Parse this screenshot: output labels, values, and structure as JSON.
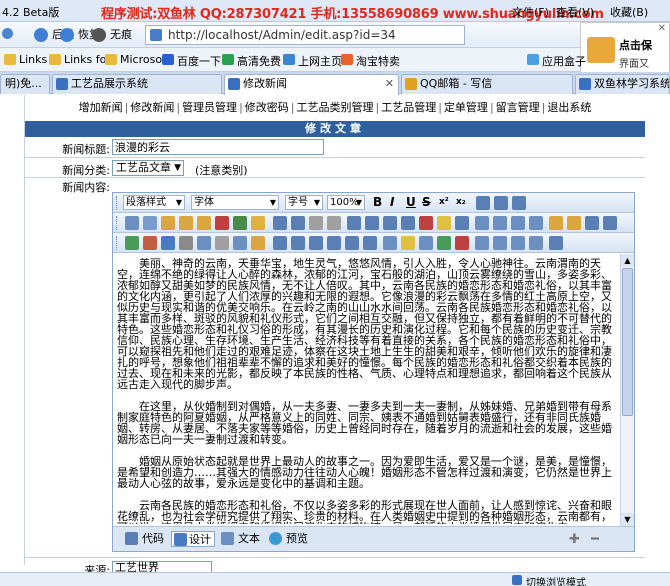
{
  "browser": {
    "app_title": "4.2 Beta版",
    "promo_text": "程序测试:双鱼林 QQ:287307421 手机:13558690869 www.shuangyulin.com",
    "menu": [
      "文件(F)",
      "查看(V)",
      "收藏(B)"
    ],
    "nav": {
      "back": "后退",
      "forward": "恢复",
      "no_record": "无痕"
    },
    "url": "http://localhost/Admin/edit.asp?id=34",
    "bookmarks": [
      "Links",
      "Links fo",
      "Microso",
      "百度一下",
      "高清免费",
      "上网主页",
      "淘宝特卖",
      "应用盒子"
    ],
    "tabs": [
      {
        "label": "明)免...",
        "active": false
      },
      {
        "label": "工艺品展示系统",
        "active": false
      },
      {
        "label": "修改新闻",
        "active": true
      },
      {
        "label": "QQ邮箱 - 写信",
        "active": false
      },
      {
        "label": "双鱼林学习系统",
        "active": false
      }
    ],
    "popup": {
      "line1": "点击保",
      "line2": "界面又"
    },
    "status_mode": "切换浏览模式"
  },
  "admin_nav": [
    "增加新闻",
    "修改新闻",
    "管理员管理",
    "修改密码",
    "工艺品类别管理",
    "工艺品管理",
    "定单管理",
    "留言管理",
    "退出系统"
  ],
  "form": {
    "header": "修改文章",
    "title_label": "新闻标题:",
    "title_value": "浪漫的彩云",
    "category_label": "新闻分类:",
    "category_value": "工艺品文章",
    "category_hint": "(注意类别)",
    "content_label": "新闻内容:",
    "source_label": "来源:",
    "source_value": "工艺世界"
  },
  "editor": {
    "paragraph_style": "段落样式",
    "font": "字体",
    "font_size": "字号",
    "zoom": "100%",
    "modes": [
      "代码",
      "设计",
      "文本",
      "预览"
    ],
    "active_mode": "设计",
    "paragraphs": [
      "美丽、神奇的云南，天垂华宝，地生灵气，悠悠风情，引人入胜，令人心驰神往。云南渭南的天空，连绵不绝的绿得让人心醉的森林，浓郁的江河，宝石般的湖泊，山顶云雾缭绕的雪山，多姿多彩、浓郁如醇又甜美如梦的民族风情，无不让人倍叹。其中，云南各民族的婚恋形态和婚恋礼俗，以其丰富的文化内涵，更引起了人们浓厚的兴趣和无限的遐想。它像浪漫的彩云飘荡在多情的红土高原上空，又似历史与现实和谐的优美交响乐。在云岭之南的山山水水间回荡。云南各民族婚恋形态和婚恋礼俗，以其丰富而多样、斑驳的风貌和礼仪形式，它们之间相互交融，但又保持独立，都有着鲜明的不可替代的特色。这些婚恋形态和礼仪习俗的形成，有其漫长的历史和演化过程。它和每个民族的历史变迁、宗教信仰、民族心理、生存环境、生产生活、经济科技等有着直接的关系，各个民族的婚恋形态和礼俗中，可以窥探祖先和他们走过的艰难足迹，体察在这块土地上生生的甜美和艰辛，倾听他们欢乐的旋律和凄扎的呼号，想象他们祖祖辈辈不懈的追求和美好的憧憬。每个民族的婚恋形态和礼俗都交织着本民族的过去、现在和未来的光影，都反映了本民族的性格、气质、心理特点和理想追求，都回响着这个民族从远古走入现代的脚步声。",
      "在这里，从伙婚制到对偶婚，从一夫多妻、一妻多夫到一夫一妻制，从姊妹婚、兄弟婚到带有母系制家庭特色的阿夏婚姻，从严格意义上的同姓、同宗、姨表不通婚到姑舅表婚盛行，还有非同氏族婚姻、转房、从妻居、不落夫家等等婚俗，历史上曾经同时存在，随着岁月的流逝和社会的发展，这些婚姻形态已向一夫一妻制过渡和转变。",
      "婚姻从原始状态起就是世界上最动人的故事之一。因为爱即生活，爱又是一个谜，是美，是憧憬，是希望和创造力……其强大的情感动力往往动人心魄！婚姻形态不管怎样过渡和演变，它仍然是世界上最动人心弦的故事，爱永远是变化中的基调和主题。",
      "云南各民族的婚恋形态和礼俗，不仅以多姿多彩的形式展现在世人面前，让人感到惊诧、兴奋和眼花缭乱，也为社会学研究提供了翔实、珍贵的材料。在人类婚姻史中提到的各种婚姻形态，云南都有，可以说，这里是人类婚姻史和婚姻发展演化史的博物馆，是一部活的人类婚姻发展史和演化史。"
    ]
  }
}
